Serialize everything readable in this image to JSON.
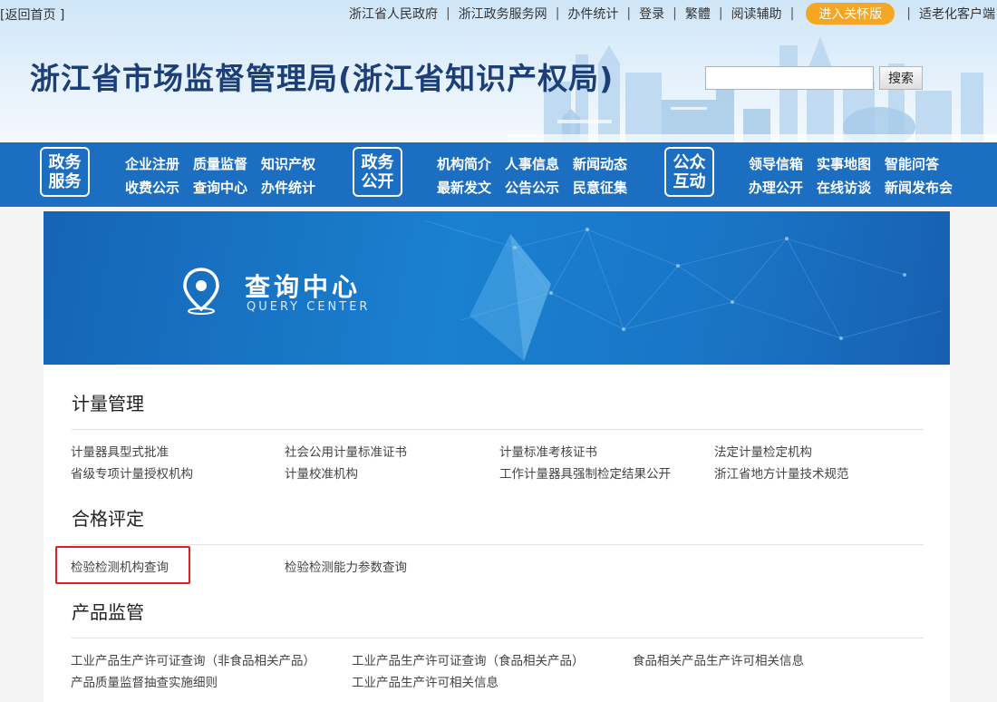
{
  "topbar": {
    "back_home": "[返回首页 ]",
    "links": [
      "浙江省人民政府",
      "浙江政务服务网",
      "办件统计",
      "登录",
      "繁體",
      "阅读辅助"
    ],
    "care_button": "进入关怀版",
    "elder_link": "适老化客户端",
    "separator": "|"
  },
  "header": {
    "site_title": "浙江省市场监督管理局(浙江省知识产权局)",
    "search_placeholder": "",
    "search_button": "搜索"
  },
  "nav": {
    "group1": {
      "line1": "政务",
      "line2": "服务",
      "row1": [
        "企业注册",
        "质量监督",
        "知识产权"
      ],
      "row2": [
        "收费公示",
        "查询中心",
        "办件统计"
      ]
    },
    "group2": {
      "line1": "政务",
      "line2": "公开",
      "row1": [
        "机构简介",
        "人事信息",
        "新闻动态"
      ],
      "row2": [
        "最新发文",
        "公告公示",
        "民意征集"
      ]
    },
    "group3": {
      "line1": "公众",
      "line2": "互动",
      "row1": [
        "领导信箱",
        "实事地图",
        "智能问答"
      ],
      "row2": [
        "办理公开",
        "在线访谈",
        "新闻发布会"
      ]
    }
  },
  "banner": {
    "title": "查询中心",
    "subtitle": "QUERY CENTER"
  },
  "sections": {
    "metrology": {
      "title": "计量管理",
      "links": [
        "计量器具型式批准",
        "社会公用计量标准证书",
        "计量标准考核证书",
        "法定计量检定机构",
        "省级专项计量授权机构",
        "计量校准机构",
        "工作计量器具强制检定结果公开",
        "浙江省地方计量技术规范"
      ]
    },
    "conformity": {
      "title": "合格评定",
      "links": [
        "检验检测机构查询",
        "检验检测能力参数查询"
      ]
    },
    "product": {
      "title": "产品监管",
      "links": [
        "工业产品生产许可证查询（非食品相关产品）",
        "工业产品生产许可证查询（食品相关产品）",
        "食品相关产品生产许可相关信息",
        "产品质量监督抽查实施细则",
        "工业产品生产许可相关信息"
      ]
    }
  },
  "colors": {
    "nav_blue": "#1b6ec0",
    "title_blue": "#1d3f78",
    "care_orange": "#f5a623",
    "highlight_red": "#e02020"
  }
}
